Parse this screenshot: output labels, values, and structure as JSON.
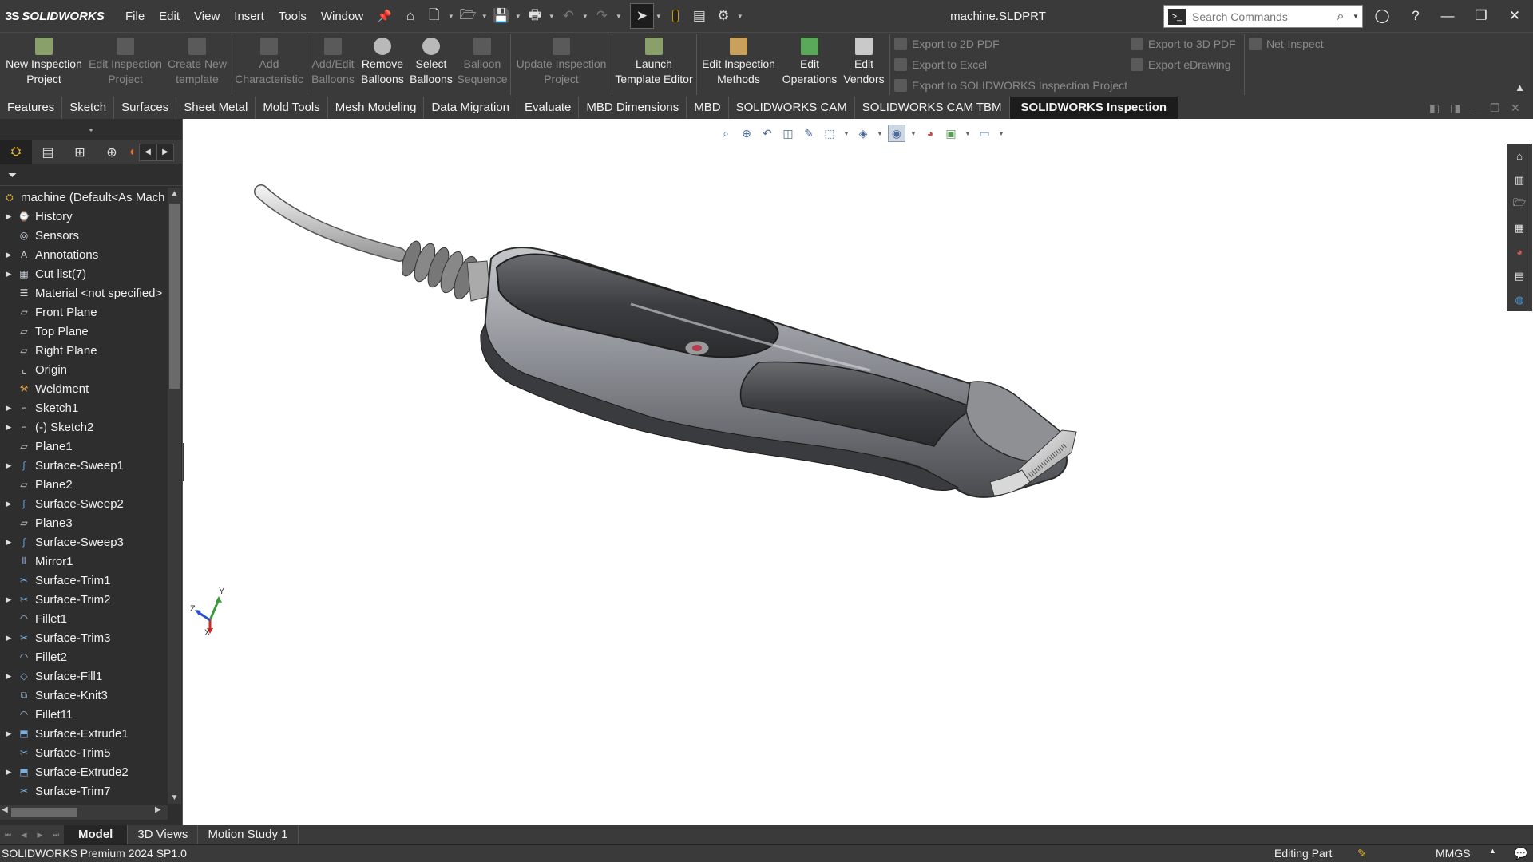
{
  "app": {
    "logo_text": "SOLIDWORKS",
    "document_title": "machine.SLDPRT"
  },
  "menus": [
    "File",
    "Edit",
    "View",
    "Insert",
    "Tools",
    "Window"
  ],
  "search": {
    "placeholder": "Search Commands"
  },
  "ribbon": {
    "buttons": [
      {
        "label": "New Inspection Project",
        "line1": "New Inspection",
        "line2": "Project",
        "enabled": true,
        "icon": "new-inspection-project-icon"
      },
      {
        "label": "Edit Inspection Project",
        "line1": "Edit Inspection",
        "line2": "Project",
        "enabled": false,
        "icon": "edit-inspection-project-icon"
      },
      {
        "label": "Create New template",
        "line1": "Create New",
        "line2": "template",
        "enabled": false,
        "icon": "create-template-icon"
      },
      {
        "label": "Add Characteristic",
        "line1": "Add",
        "line2": "Characteristic",
        "enabled": false,
        "icon": "add-characteristic-icon"
      },
      {
        "label": "Add/Edit Balloons",
        "line1": "Add/Edit",
        "line2": "Balloons",
        "enabled": false,
        "icon": "balloons-icon"
      },
      {
        "label": "Remove Balloons",
        "line1": "Remove",
        "line2": "Balloons",
        "enabled": true,
        "icon": "remove-balloons-icon"
      },
      {
        "label": "Select Balloons",
        "line1": "Select",
        "line2": "Balloons",
        "enabled": true,
        "icon": "select-balloons-icon"
      },
      {
        "label": "Balloon Sequence",
        "line1": "Balloon",
        "line2": "Sequence",
        "enabled": false,
        "icon": "balloon-sequence-icon"
      },
      {
        "label": "Update Inspection Project",
        "line1": "Update Inspection",
        "line2": "Project",
        "enabled": false,
        "icon": "update-project-icon"
      },
      {
        "label": "Launch Template Editor",
        "line1": "Launch",
        "line2": "Template Editor",
        "enabled": true,
        "icon": "template-editor-icon"
      },
      {
        "label": "Edit Inspection Methods",
        "line1": "Edit Inspection",
        "line2": "Methods",
        "enabled": true,
        "icon": "inspection-methods-icon"
      },
      {
        "label": "Edit Operations",
        "line1": "Edit",
        "line2": "Operations",
        "enabled": true,
        "icon": "operations-icon"
      },
      {
        "label": "Edit Vendors",
        "line1": "Edit",
        "line2": "Vendors",
        "enabled": true,
        "icon": "vendors-icon"
      }
    ],
    "export": {
      "pdf2d": "Export to 2D PDF",
      "excel": "Export to Excel",
      "sw_inspection": "Export to SOLIDWORKS Inspection Project",
      "pdf3d": "Export to 3D PDF",
      "edrawing": "Export eDrawing",
      "net_inspect": "Net-Inspect"
    }
  },
  "command_tabs": [
    "Features",
    "Sketch",
    "Surfaces",
    "Sheet Metal",
    "Mold Tools",
    "Mesh Modeling",
    "Data Migration",
    "Evaluate",
    "MBD Dimensions",
    "MBD",
    "SOLIDWORKS CAM",
    "SOLIDWORKS CAM TBM",
    "SOLIDWORKS Inspection"
  ],
  "active_command_tab": "SOLIDWORKS Inspection",
  "feature_tree": {
    "root": "machine  (Default<As Mach",
    "items": [
      {
        "label": "History",
        "expandable": true,
        "icon": "history-icon"
      },
      {
        "label": "Sensors",
        "expandable": false,
        "icon": "sensors-icon"
      },
      {
        "label": "Annotations",
        "expandable": true,
        "icon": "annotations-icon"
      },
      {
        "label": "Cut list(7)",
        "expandable": true,
        "icon": "cut-list-icon"
      },
      {
        "label": "Material <not specified>",
        "expandable": false,
        "icon": "material-icon"
      },
      {
        "label": "Front Plane",
        "expandable": false,
        "icon": "plane-icon"
      },
      {
        "label": "Top Plane",
        "expandable": false,
        "icon": "plane-icon"
      },
      {
        "label": "Right Plane",
        "expandable": false,
        "icon": "plane-icon"
      },
      {
        "label": "Origin",
        "expandable": false,
        "icon": "origin-icon"
      },
      {
        "label": "Weldment",
        "expandable": false,
        "icon": "weldment-icon"
      },
      {
        "label": "Sketch1",
        "expandable": true,
        "icon": "sketch-icon"
      },
      {
        "label": "(-) Sketch2",
        "expandable": true,
        "icon": "sketch-icon"
      },
      {
        "label": "Plane1",
        "expandable": false,
        "icon": "plane-icon"
      },
      {
        "label": "Surface-Sweep1",
        "expandable": true,
        "icon": "sweep-icon"
      },
      {
        "label": "Plane2",
        "expandable": false,
        "icon": "plane-icon"
      },
      {
        "label": "Surface-Sweep2",
        "expandable": true,
        "icon": "sweep-icon"
      },
      {
        "label": "Plane3",
        "expandable": false,
        "icon": "plane-icon"
      },
      {
        "label": "Surface-Sweep3",
        "expandable": true,
        "icon": "sweep-icon"
      },
      {
        "label": "Mirror1",
        "expandable": false,
        "icon": "mirror-icon"
      },
      {
        "label": "Surface-Trim1",
        "expandable": false,
        "icon": "trim-icon"
      },
      {
        "label": "Surface-Trim2",
        "expandable": true,
        "icon": "trim-icon"
      },
      {
        "label": "Fillet1",
        "expandable": false,
        "icon": "fillet-icon"
      },
      {
        "label": "Surface-Trim3",
        "expandable": true,
        "icon": "trim-icon"
      },
      {
        "label": "Fillet2",
        "expandable": false,
        "icon": "fillet-icon"
      },
      {
        "label": "Surface-Fill1",
        "expandable": true,
        "icon": "fill-icon"
      },
      {
        "label": "Surface-Knit3",
        "expandable": false,
        "icon": "knit-icon"
      },
      {
        "label": "Fillet11",
        "expandable": false,
        "icon": "fillet-icon"
      },
      {
        "label": "Surface-Extrude1",
        "expandable": true,
        "icon": "extrude-icon"
      },
      {
        "label": "Surface-Trim5",
        "expandable": false,
        "icon": "trim-icon"
      },
      {
        "label": "Surface-Extrude2",
        "expandable": true,
        "icon": "extrude-icon"
      },
      {
        "label": "Surface-Trim7",
        "expandable": false,
        "icon": "trim-icon"
      }
    ]
  },
  "triad": {
    "x": "X",
    "y": "Y",
    "z": "Z"
  },
  "bottom_tabs": [
    "Model",
    "3D Views",
    "Motion Study 1"
  ],
  "active_bottom_tab": "Model",
  "status": {
    "version": "SOLIDWORKS Premium 2024 SP1.0",
    "mode": "Editing Part",
    "units": "MMGS"
  },
  "colors": {
    "chrome": "#3a3a3a",
    "active_tab": "#1c1c1c",
    "viewport": "#ffffff",
    "accent_blue": "#1e6fd9"
  }
}
